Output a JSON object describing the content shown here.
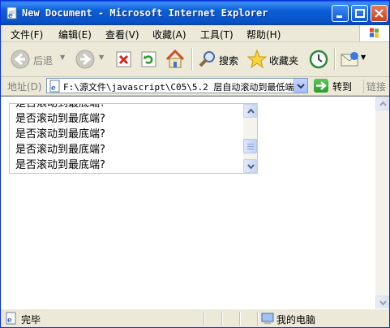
{
  "window": {
    "title": "New Document - Microsoft Internet Explorer"
  },
  "menu": {
    "items": [
      "文件(F)",
      "编辑(E)",
      "查看(V)",
      "收藏(A)",
      "工具(T)",
      "帮助(H)"
    ]
  },
  "toolbar": {
    "back_label": "后退",
    "search_label": "搜索",
    "favorites_label": "收藏夹"
  },
  "address": {
    "label": "地址(D)",
    "url": "F:\\源文件\\javascript\\C05\\5.2  层自动滚动到最低端",
    "go_label": "转到",
    "links_label": "链接"
  },
  "content": {
    "lines": [
      "是否滚动到最底端?",
      "是否滚动到最底端?",
      "是否滚动到最底端?",
      "是否滚动到最底端?",
      "是否滚动到最底端?"
    ]
  },
  "status": {
    "text": "完毕",
    "zone": "我的电脑"
  },
  "colors": {
    "titlebar": "#0a5fd8",
    "chrome": "#ece9d8",
    "close_button": "#c5421f"
  }
}
